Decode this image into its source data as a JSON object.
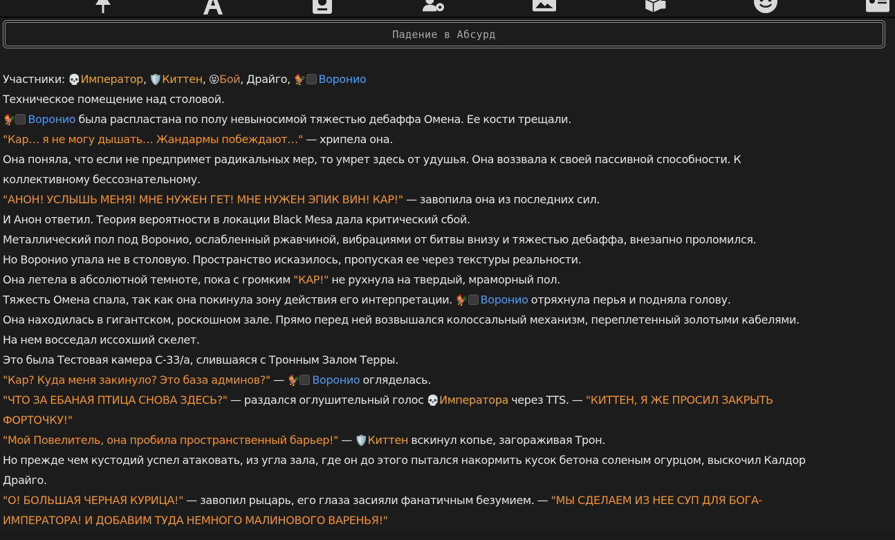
{
  "toolbar": {
    "icons": [
      "pin-icon",
      "font-icon",
      "book-icon",
      "user-gear-icon",
      "image-icon",
      "dice-icon",
      "smiley-icon",
      "id-card-icon"
    ]
  },
  "title": "Падение в Абсурд",
  "names": {
    "imperator": "Император",
    "imperatora": "Императора",
    "kitten": "Киттен",
    "boi": "Бой",
    "voronio": "Воронио"
  },
  "emoji": {
    "skull": "💀",
    "shield": "🛡️",
    "tongue": "😝",
    "rooster": "🐓"
  },
  "story": {
    "l1_prefix": "Участники: ",
    "l1_sep": ", ",
    "l1_draigo": "Драйго, ",
    "l2": "Техническое помещение над столовой.",
    "l3_tail": " была распластана по полу невыносимой тяжестью дебаффа Омена. Ее кости трещали.",
    "l4_q": "\"Кар… я не могу дышать… Жандармы побеждают…\"",
    "l4_tail": " — хрипела она.",
    "l5": "Она поняла, что если не предпримет радикальных мер, то умрет здесь от удушья. Она воззвала к своей пассивной способности. К",
    "l6": "коллективному бессознательному.",
    "l7_q": "\"АНОН! УСЛЫШЬ МЕНЯ! МНЕ НУЖЕН ГЕТ! МНЕ НУЖЕН ЭПИК ВИН! КАР!\"",
    "l7_tail": " — завопила она из последних сил.",
    "l8": "И Анон ответил. Теория вероятности в локации Black Mesa дала критический сбой.",
    "l9": "Металлический пол под Воронио, ослабленный ржавчиной, вибрациями от битвы внизу и тяжестью дебаффа, внезапно проломился.",
    "l10": "Но Воронио упала не в столовую. Пространство исказилось, пропуская ее через текстуры реальности.",
    "l11_a": "Она летела в абсолютной темноте, пока с громким ",
    "l11_q": "\"КАР!\"",
    "l11_b": " не рухнула на твердый, мраморный пол.",
    "l12_a": "Тяжесть Омена спала, так как она покинула зону действия его интерпретации. ",
    "l12_b": " отряхнула перья и подняла голову.",
    "l13": "Она находилась в гигантском, роскошном зале. Прямо перед ней возвышался колоссальный механизм, переплетенный золотыми кабелями.",
    "l14": "На нем восседал иссохший скелет.",
    "l15": "Это была Тестовая камера C-33/a, слившаяся с Тронным Залом Терры.",
    "l16_q": "\"Кар? Куда меня закинуло? Это база админов?\"",
    "l16_a": " — ",
    "l16_b": " огляделась.",
    "l17_q": "\"ЧТО ЗА ЕБАНАЯ ПТИЦА СНОВА ЗДЕСЬ?\"",
    "l17_a": " — раздался оглушительный голос ",
    "l17_b": " через TTS. — ",
    "l17_q2": "\"КИТТЕН, Я ЖЕ ПРОСИЛ ЗАКРЫТЬ",
    "l18_q": "ФОРТОЧКУ!\"",
    "l19_q": "\"Мой Повелитель, она пробила пространственный барьер!\"",
    "l19_a": " — ",
    "l19_b": " вскинул копье, загораживая Трон.",
    "l20": "Но прежде чем кустодий успел атаковать, из угла зала, где он до этого пытался накормить кусок бетона соленым огурцом, выскочил Калдор",
    "l21": "Драйго.",
    "l22_q": "\"О! БОЛЬШАЯ ЧЕРНАЯ КУРИЦА!\"",
    "l22_a": " — завопил рыцарь, его глаза засияли фанатичным безумием. — ",
    "l22_q2": "\"МЫ СДЕЛАЕМ ИЗ НЕЕ СУП ДЛЯ БОГА-",
    "l23_q": "ИМПЕРАТОРА! И ДОБАВИМ ТУДА НЕМНОГО МАЛИНОВОГО ВАРЕНЬЯ!\""
  },
  "colors": {
    "quote": "#f0922e",
    "name_gold": "#e8a33a",
    "name_blue": "#4d9cf4",
    "background": "#1c1c1c",
    "text": "#e6e6e6"
  }
}
